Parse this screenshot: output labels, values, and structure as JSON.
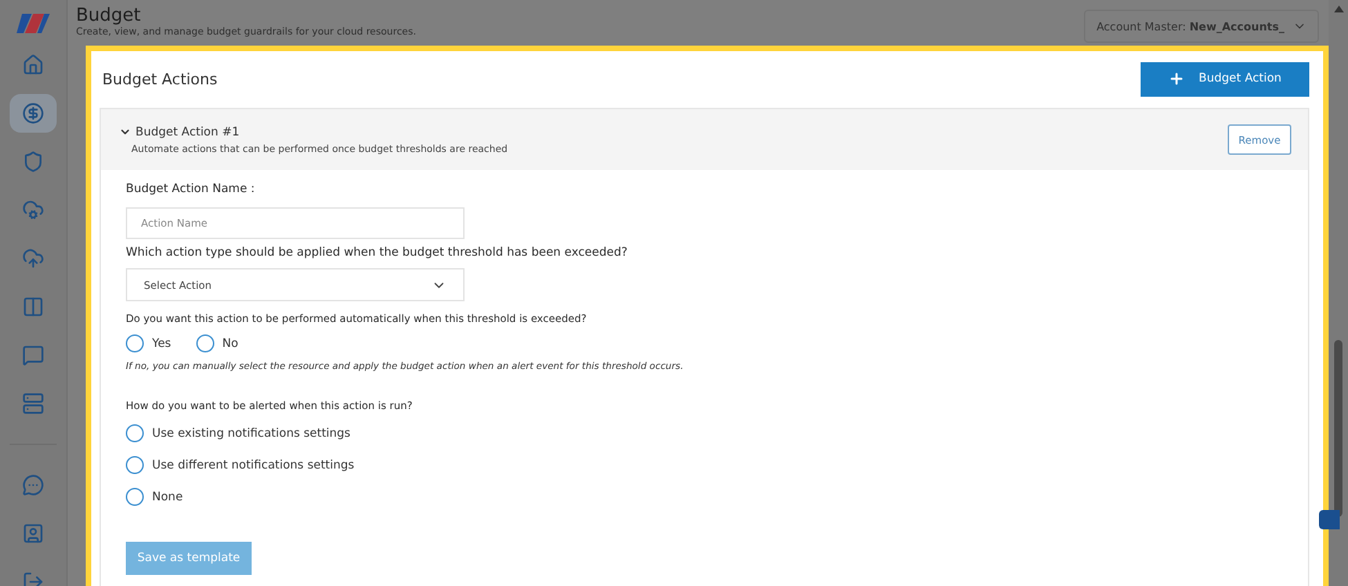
{
  "header": {
    "title": "Budget",
    "subtitle": "Create, view, and manage budget guardrails for your cloud resources.",
    "account": {
      "label": "Account Master:",
      "value": "New_Accounts_"
    }
  },
  "sidebar": {
    "items": [
      {
        "kind": "home",
        "selected": false
      },
      {
        "kind": "dollar",
        "selected": true
      },
      {
        "kind": "shield",
        "selected": false
      },
      {
        "kind": "cloud-network",
        "selected": false
      },
      {
        "kind": "cloud-upload",
        "selected": false
      },
      {
        "kind": "columns",
        "selected": false
      },
      {
        "kind": "chat",
        "selected": false
      },
      {
        "kind": "server",
        "selected": false
      }
    ],
    "bottom_items": [
      {
        "kind": "message",
        "selected": false
      },
      {
        "kind": "user",
        "selected": false
      },
      {
        "kind": "logout",
        "selected": false
      }
    ]
  },
  "panel": {
    "title": "Budget Actions",
    "add_button": "Budget Action",
    "action": {
      "title": "Budget Action #1",
      "description": "Automate actions that can be performed once budget thresholds are reached",
      "expanded": true,
      "remove_button": "Remove",
      "name_label": "Budget Action Name :",
      "name_field": {
        "placeholder": "Action Name"
      },
      "type_label": "Which action type should be applied when the budget threshold has been exceeded?",
      "type_select": {
        "placeholder": "Select Action"
      },
      "auto_label": "Do you want this action to be performed automatically when this threshold is exceeded?",
      "auto_options": [
        {
          "label": "Yes",
          "selected": false
        },
        {
          "label": "No",
          "selected": false
        }
      ],
      "auto_note": "If no, you can manually select the resource and apply the budget action when an alert event for this threshold occurs.",
      "alert_label": "How do you want to be alerted when this action is run?",
      "alert_options": [
        {
          "label": "Use existing notifications settings",
          "selected": false
        },
        {
          "label": "Use different notifications settings",
          "selected": false
        },
        {
          "label": "None",
          "selected": false
        }
      ],
      "save_button": "Save as template"
    }
  }
}
